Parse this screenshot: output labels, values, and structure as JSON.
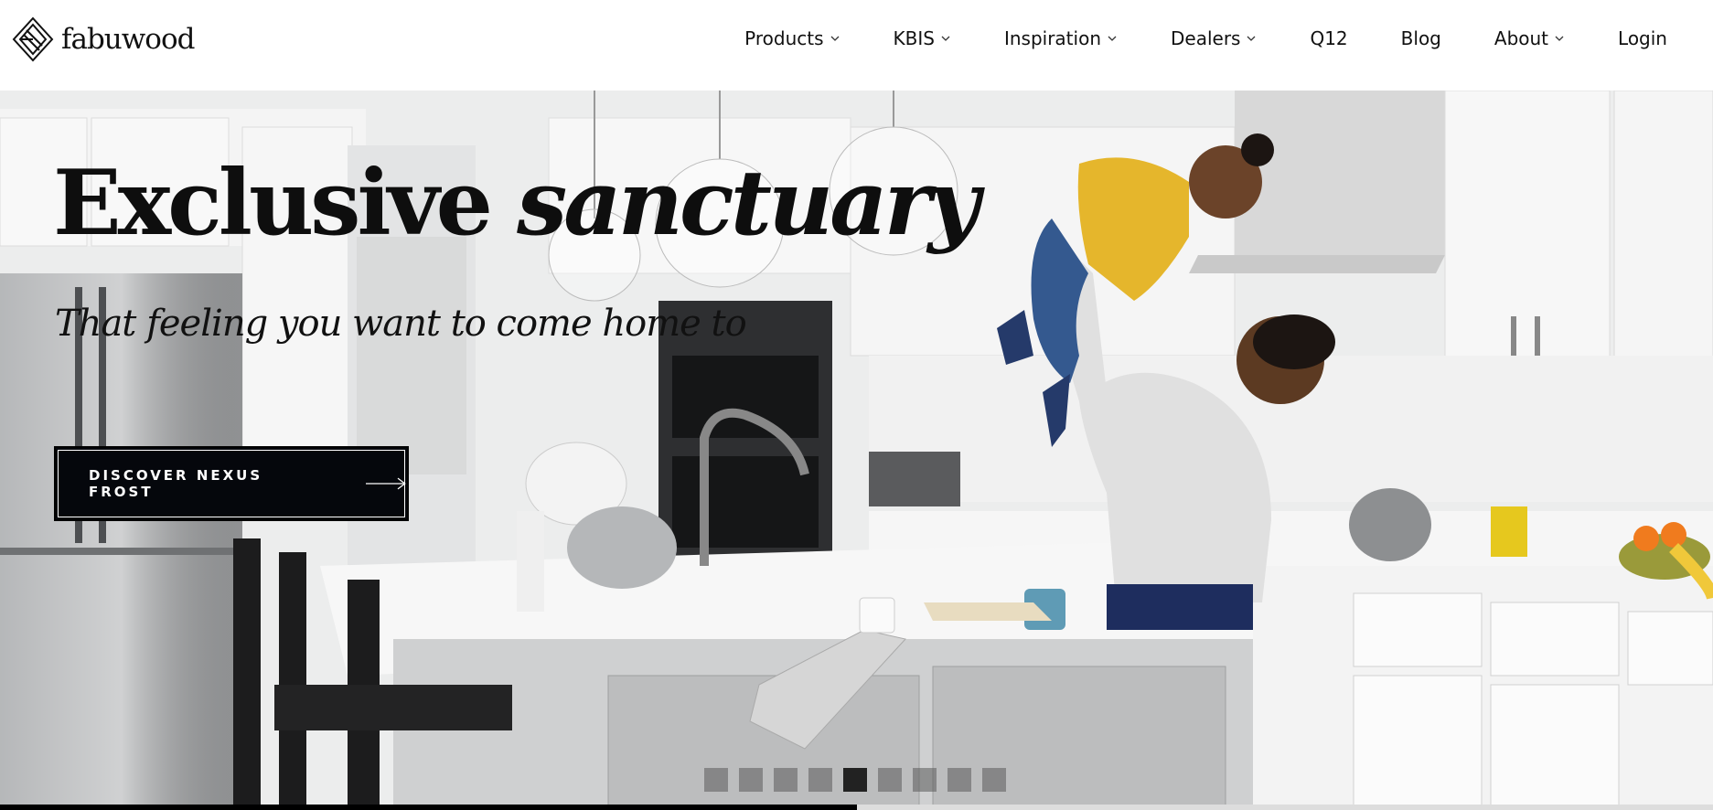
{
  "brand": {
    "name": "fabuwood"
  },
  "nav": {
    "items": [
      {
        "label": "Products",
        "has_dropdown": true
      },
      {
        "label": "KBIS",
        "has_dropdown": true
      },
      {
        "label": "Inspiration",
        "has_dropdown": true
      },
      {
        "label": "Dealers",
        "has_dropdown": true
      },
      {
        "label": "Q12",
        "has_dropdown": false
      },
      {
        "label": "Blog",
        "has_dropdown": false
      },
      {
        "label": "About",
        "has_dropdown": true
      },
      {
        "label": "Login",
        "has_dropdown": false
      }
    ]
  },
  "hero": {
    "title_plain": "Exclusive",
    "title_italic": "sanctuary",
    "subtitle": "That feeling you want to come home to",
    "cta_label": "DISCOVER NEXUS FROST",
    "cta_icon": "arrow-right-icon",
    "slides_total": 9,
    "active_slide": 5,
    "progress": 0.5
  },
  "colors": {
    "cta_background": "#05070c",
    "text": "#111111",
    "dot_inactive": "#8a8a8a",
    "dot_active": "#222222"
  }
}
